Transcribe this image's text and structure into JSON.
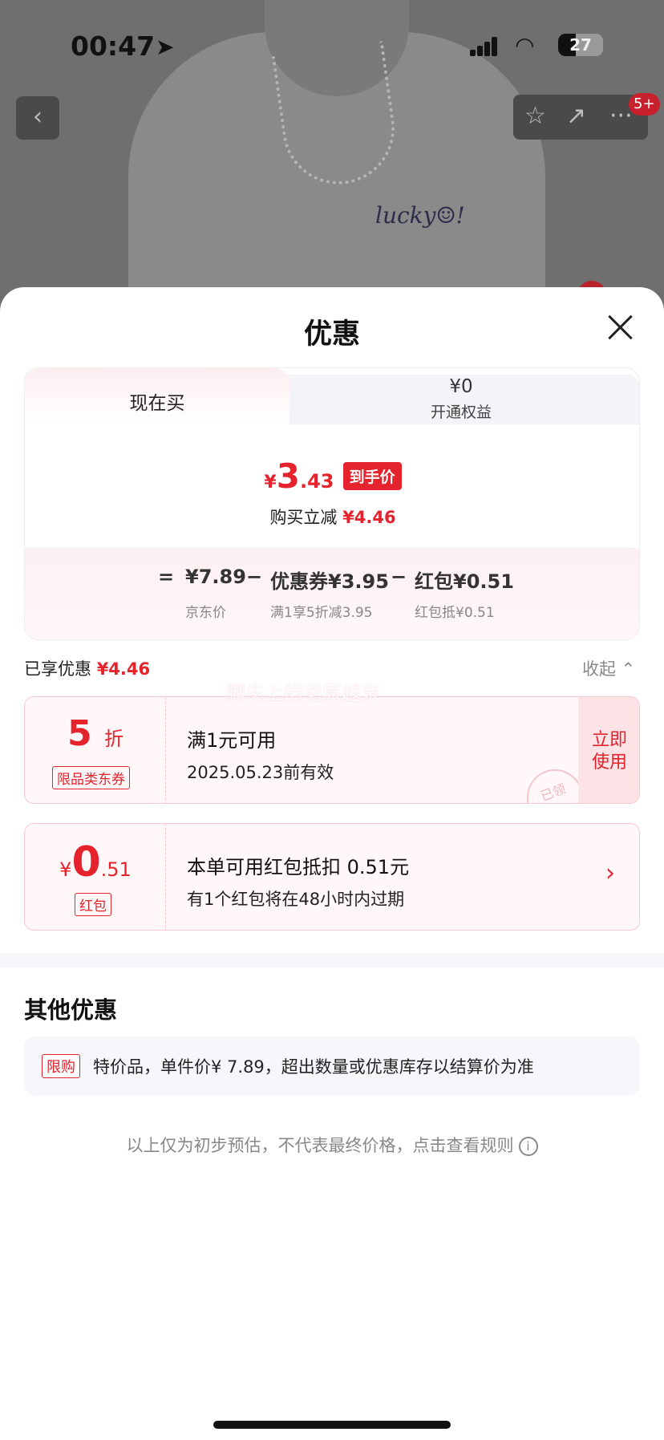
{
  "status": {
    "time": "00:47",
    "battery": "27"
  },
  "background": {
    "print_text": "lucky☺!"
  },
  "badge": "5+",
  "sheet": {
    "title": "优惠"
  },
  "tabs": {
    "now": "现在买",
    "member_value": "¥0",
    "member_label": "开通权益"
  },
  "final_price": {
    "currency": "¥",
    "integer": "3",
    "decimal": ".43",
    "tag": "到手价"
  },
  "saving": {
    "label": "购买立减",
    "amount": "¥4.46"
  },
  "formula": {
    "equals": "=",
    "minus": "−",
    "jd_price": "¥7.89",
    "jd_price_label": "京东价",
    "coupon": "优惠券¥3.95",
    "coupon_label": "满1享5折减3.95",
    "redpacket": "红包¥0.51",
    "redpacket_label": "红包抵¥0.51"
  },
  "enjoyed": {
    "label": "已享优惠",
    "amount": "¥4.46",
    "collapse": "收起 ⌃"
  },
  "watermark": "脚尖上的老原越来",
  "coupon1": {
    "value": "5",
    "unit": "折",
    "type": "限品类东券",
    "title": "满1元可用",
    "expiry": "2025.05.23前有效",
    "use_line1": "立即",
    "use_line2": "使用",
    "stamp": "已领"
  },
  "coupon2": {
    "currency": "¥",
    "integer": "0",
    "decimal": ".51",
    "type": "红包",
    "title": "本单可用红包抵扣 0.51元",
    "note": "有1个红包将在48小时内过期"
  },
  "other": {
    "title": "其他优惠",
    "limit_tag": "限购",
    "limit_text": "特价品，单件价¥ 7.89，超出数量或优惠库存以结算价为准"
  },
  "footer": "以上仅为初步预估，不代表最终价格，点击查看规则"
}
